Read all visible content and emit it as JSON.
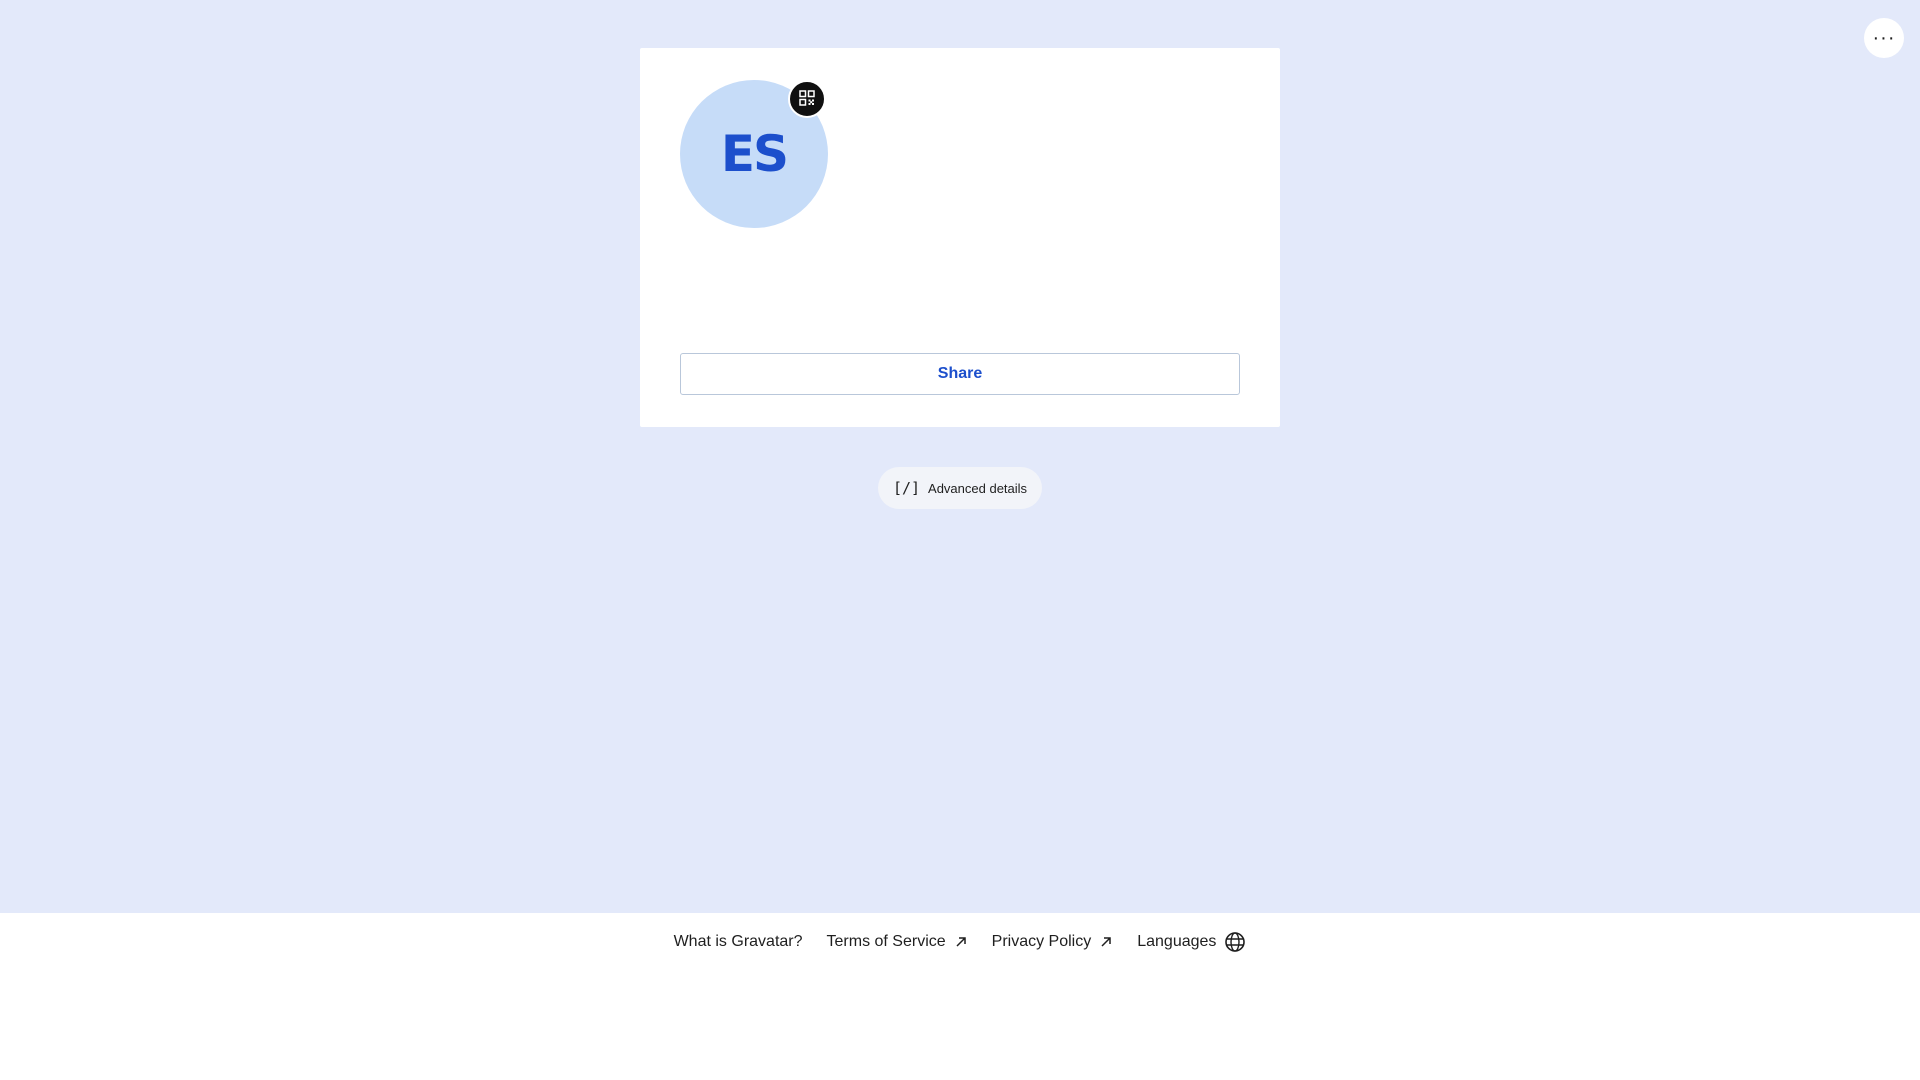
{
  "header": {
    "menu_icon": "more-horizontal-icon",
    "menu_label": "···"
  },
  "profile": {
    "initials": "ES",
    "avatar_bg": "#c6dcf8",
    "initials_color": "#1c4fcc",
    "qr_icon": "qr-code-icon",
    "share_label": "Share"
  },
  "advanced": {
    "icon_text": "[/]",
    "label": "Advanced details"
  },
  "footer": {
    "links": [
      {
        "label": "What is Gravatar?",
        "icon": ""
      },
      {
        "label": "Terms of Service",
        "icon": "external-link-icon"
      },
      {
        "label": "Privacy Policy",
        "icon": "external-link-icon"
      },
      {
        "label": "Languages",
        "icon": "globe-icon"
      }
    ]
  },
  "colors": {
    "page_bg": "#e3e9fa",
    "accent": "#1c4fcc"
  }
}
